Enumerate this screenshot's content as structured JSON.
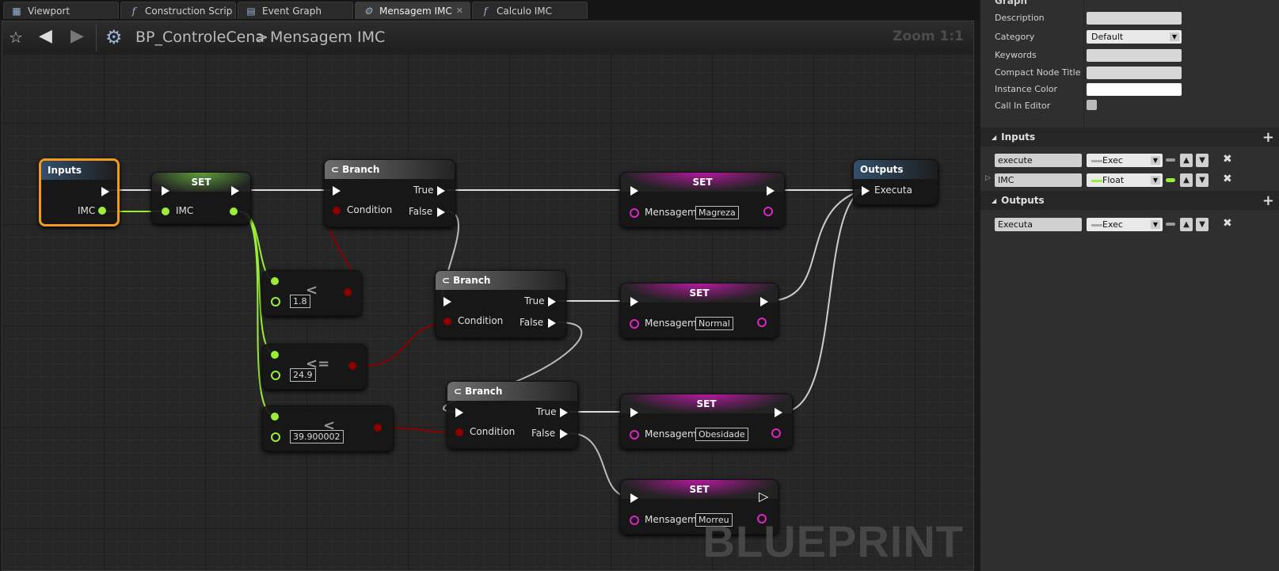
{
  "tabs": [
    {
      "label": "Viewport",
      "icon": "viewport-icon"
    },
    {
      "label": "Construction Scrip",
      "icon": "function-icon"
    },
    {
      "label": "Event Graph",
      "icon": "graph-icon"
    },
    {
      "label": "Mensagem IMC",
      "icon": "gear-icon"
    },
    {
      "label": "Calculo IMC",
      "icon": "function-icon"
    }
  ],
  "toolbar": {
    "breadcrumb_root": "BP_ControleCena",
    "breadcrumb_sep": ">",
    "breadcrumb_current": "Mensagem IMC",
    "zoom": "Zoom 1:1"
  },
  "watermark": "BLUEPRINT",
  "nodes": {
    "inputs": {
      "title": "Inputs",
      "pin": "IMC"
    },
    "set_imc": {
      "title": "SET",
      "pin": "IMC"
    },
    "branch1": {
      "title": "Branch",
      "true": "True",
      "false": "False",
      "cond": "Condition"
    },
    "branch2": {
      "title": "Branch",
      "true": "True",
      "false": "False",
      "cond": "Condition"
    },
    "branch3": {
      "title": "Branch",
      "true": "True",
      "false": "False",
      "cond": "Condition"
    },
    "cmp1": {
      "op": "<",
      "value": "1.8"
    },
    "cmp2": {
      "op": "<=",
      "value": "24.9"
    },
    "cmp3": {
      "op": "<",
      "value": "39.900002"
    },
    "set_magreza": {
      "title": "SET",
      "pin": "Mensagem",
      "value": "Magreza"
    },
    "set_normal": {
      "title": "SET",
      "pin": "Mensagem",
      "value": "Normal"
    },
    "set_obesidade": {
      "title": "SET",
      "pin": "Mensagem",
      "value": "Obesidade"
    },
    "set_morreu": {
      "title": "SET",
      "pin": "Mensagem",
      "value": "Morreu"
    },
    "outputs": {
      "title": "Outputs",
      "pin": "Executa"
    }
  },
  "panel": {
    "graph_header": "Graph",
    "rows": [
      "Description",
      "Category",
      "Keywords",
      "Compact Node Title",
      "Instance Color",
      "Call In Editor"
    ],
    "category_value": "Default",
    "inputs_header": "Inputs",
    "outputs_header": "Outputs",
    "inputs": [
      {
        "name": "execute",
        "type": "Exec"
      },
      {
        "name": "IMC",
        "type": "Float"
      }
    ],
    "outputs": [
      {
        "name": "Executa",
        "type": "Exec"
      }
    ]
  },
  "colors": {
    "exec": "#ffffff",
    "float": "#9ced3a",
    "bool": "#8c0000",
    "string": "#e023c4",
    "selection": "#f09a22"
  }
}
